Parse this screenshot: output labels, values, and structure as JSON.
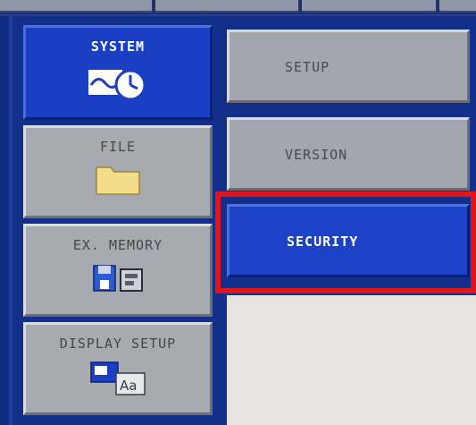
{
  "menu": {
    "items": [
      {
        "label": "SYSTEM",
        "icon": "clock-waveform-icon",
        "active": true
      },
      {
        "label": "FILE",
        "icon": "folder-icon",
        "active": false
      },
      {
        "label": "EX. MEMORY",
        "icon": "floppy-disk-card-icon",
        "active": false
      },
      {
        "label": "DISPLAY SETUP",
        "icon": "display-font-icon",
        "active": false
      }
    ]
  },
  "submenu": {
    "items": [
      {
        "label": "SETUP",
        "selected": false
      },
      {
        "label": "VERSION",
        "selected": false
      },
      {
        "label": "SECURITY",
        "selected": true
      }
    ]
  },
  "colors": {
    "background": "#0e2c7e",
    "active_button": "#1a3fc4",
    "inactive_button": "#a8aab2",
    "highlight_frame": "#e0141c"
  }
}
